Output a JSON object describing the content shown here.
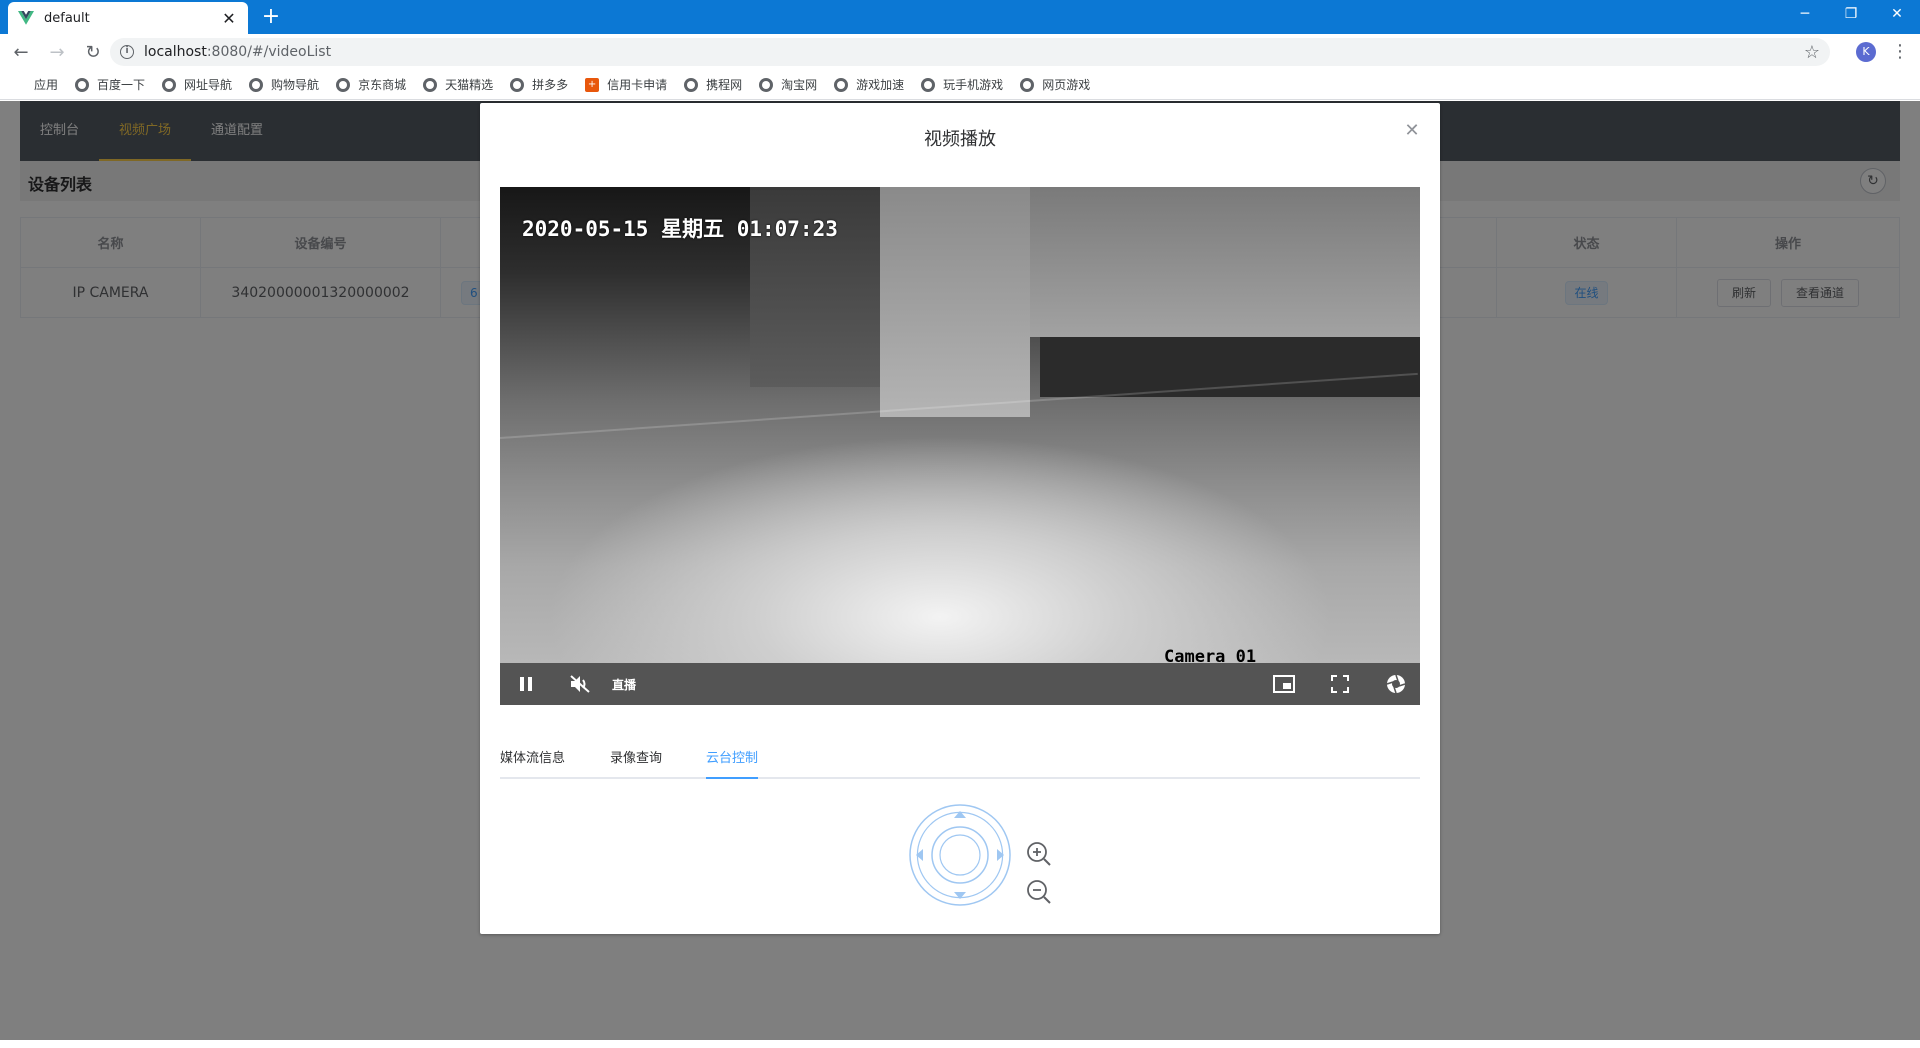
{
  "browser": {
    "tab_title": "default",
    "url_host": "localhost",
    "url_rest": ":8080/#/videoList",
    "avatar_letter": "K",
    "accent_color": "#0c78d4",
    "bookmarks": [
      {
        "label": "应用",
        "icon": "apps-grid-icon"
      },
      {
        "label": "百度一下",
        "icon": "globe-icon"
      },
      {
        "label": "网址导航",
        "icon": "globe-icon"
      },
      {
        "label": "购物导航",
        "icon": "globe-icon"
      },
      {
        "label": "京东商城",
        "icon": "globe-icon"
      },
      {
        "label": "天猫精选",
        "icon": "globe-icon"
      },
      {
        "label": "拼多多",
        "icon": "globe-icon"
      },
      {
        "label": "信用卡申请",
        "icon": "card-icon"
      },
      {
        "label": "携程网",
        "icon": "globe-icon"
      },
      {
        "label": "淘宝网",
        "icon": "globe-icon"
      },
      {
        "label": "游戏加速",
        "icon": "globe-icon"
      },
      {
        "label": "玩手机游戏",
        "icon": "globe-icon"
      },
      {
        "label": "网页游戏",
        "icon": "globe-icon"
      }
    ]
  },
  "app": {
    "nav": [
      "控制台",
      "视频广场",
      "通道配置"
    ],
    "nav_active_index": 1,
    "page_title": "设备列表",
    "table": {
      "headers": [
        "名称",
        "设备编号",
        "状态",
        "操作"
      ],
      "row": {
        "name": "IP CAMERA",
        "device_id": "34020000001320000002",
        "tag": "6",
        "status": "在线",
        "actions": [
          "刷新",
          "查看通道"
        ]
      }
    }
  },
  "dialog": {
    "title": "视频播放",
    "video": {
      "timestamp": "2020-05-15 星期五 01:07:23",
      "caption": "Camera 01",
      "live_label": "直播"
    },
    "tabs": [
      "媒体流信息",
      "录像查询",
      "云台控制"
    ],
    "active_tab_index": 2
  },
  "colors": {
    "primary": "#409eff",
    "nav_bg": "#545c64",
    "nav_active": "#ffd04b"
  }
}
